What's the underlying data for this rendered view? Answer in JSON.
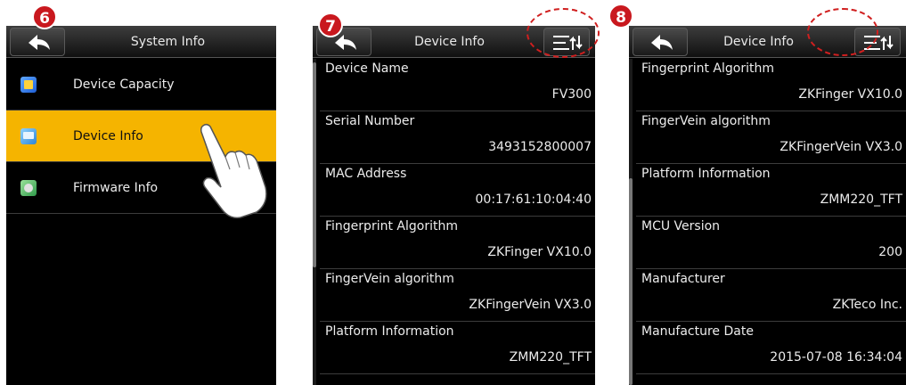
{
  "steps": {
    "step6": "6",
    "step7": "7",
    "step8": "8"
  },
  "screen6": {
    "title": "System Info",
    "items": [
      {
        "label": "Device Capacity",
        "icon": "device-capacity-icon"
      },
      {
        "label": "Device Info",
        "icon": "device-info-icon",
        "selected": true
      },
      {
        "label": "Firmware Info",
        "icon": "firmware-info-icon"
      }
    ]
  },
  "screen7": {
    "title": "Device Info",
    "items": [
      {
        "label": "Device Name",
        "value": "FV300"
      },
      {
        "label": "Serial Number",
        "value": "3493152800007"
      },
      {
        "label": "MAC Address",
        "value": "00:17:61:10:04:40"
      },
      {
        "label": "Fingerprint Algorithm",
        "value": "ZKFinger VX10.0"
      },
      {
        "label": "FingerVein algorithm",
        "value": "ZKFingerVein VX3.0"
      },
      {
        "label": "Platform Information",
        "value": "ZMM220_TFT"
      }
    ]
  },
  "screen8": {
    "title": "Device Info",
    "items": [
      {
        "label": "Fingerprint Algorithm",
        "value": "ZKFinger VX10.0"
      },
      {
        "label": "FingerVein algorithm",
        "value": "ZKFingerVein VX3.0"
      },
      {
        "label": "Platform Information",
        "value": "ZMM220_TFT"
      },
      {
        "label": "MCU Version",
        "value": "200"
      },
      {
        "label": "Manufacturer",
        "value": "ZKTeco Inc."
      },
      {
        "label": "Manufacture Date",
        "value": "2015-07-08 16:34:04"
      }
    ]
  },
  "colors": {
    "selected": "#f5b400",
    "badge": "#c9181e",
    "callout": "#d01f1f"
  }
}
